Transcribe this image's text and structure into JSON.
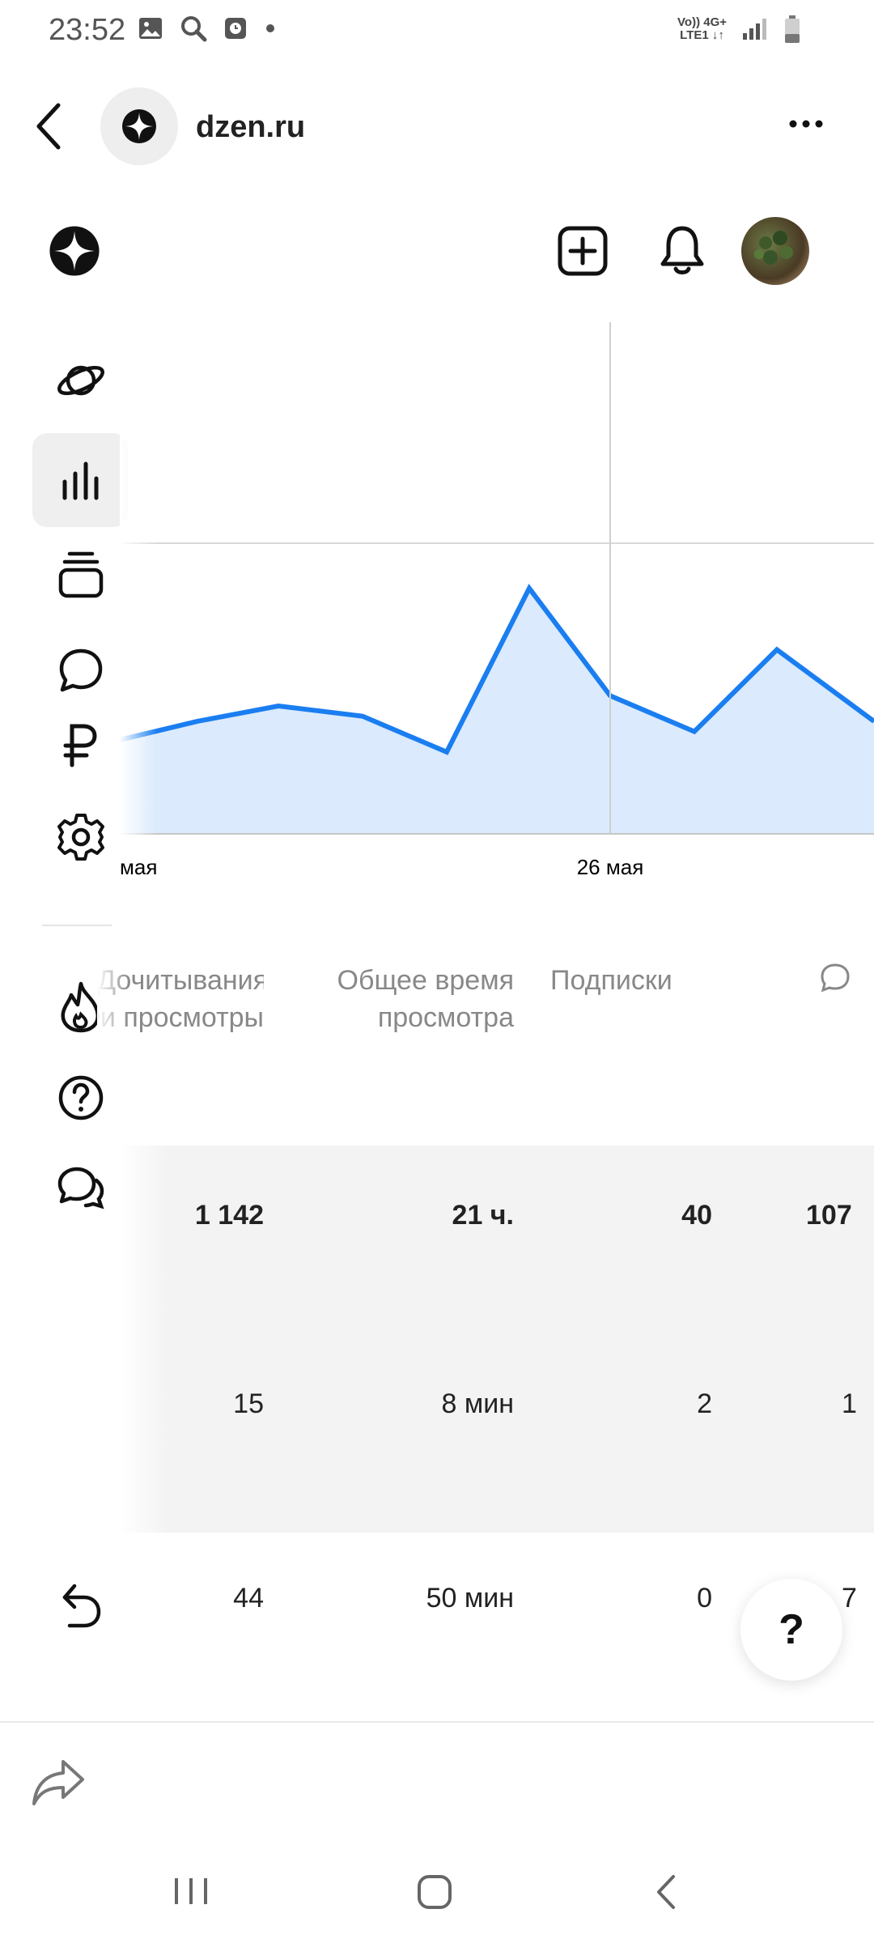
{
  "status_bar": {
    "time": "23:52",
    "network_top": "Vo)) 4G+",
    "network_bottom": "LTE1 ↓↑",
    "icons": [
      "gallery-icon",
      "search-icon",
      "clock-app-icon",
      "dot-icon",
      "signal-icon",
      "battery-icon"
    ]
  },
  "browser": {
    "domain": "dzen.ru"
  },
  "chart_data": {
    "type": "area",
    "x_ticks_visible": [
      "мая",
      "26 мая"
    ],
    "series": [
      {
        "values": [
          0.18,
          0.22,
          0.25,
          0.23,
          0.16,
          0.48,
          0.27,
          0.2,
          0.36,
          0.22
        ]
      }
    ],
    "color": "#1a7ef0",
    "fill": "#dbeafc"
  },
  "table": {
    "headers": [
      [
        "Дочитывания",
        "и просмотры"
      ],
      [
        "Общее время",
        "просмотра"
      ],
      [
        "Подписки"
      ]
    ],
    "rows": [
      [
        "1 142",
        "21 ч.",
        "40",
        "107"
      ],
      [
        "15",
        "8 мин",
        "2",
        "1"
      ],
      [
        "44",
        "50 мин",
        "0",
        "7"
      ]
    ]
  },
  "help_button": {
    "label": "?"
  },
  "colors": {
    "accent": "#1a7ef0",
    "active_bg": "#efefef",
    "table_band": "#f3f3f3"
  }
}
